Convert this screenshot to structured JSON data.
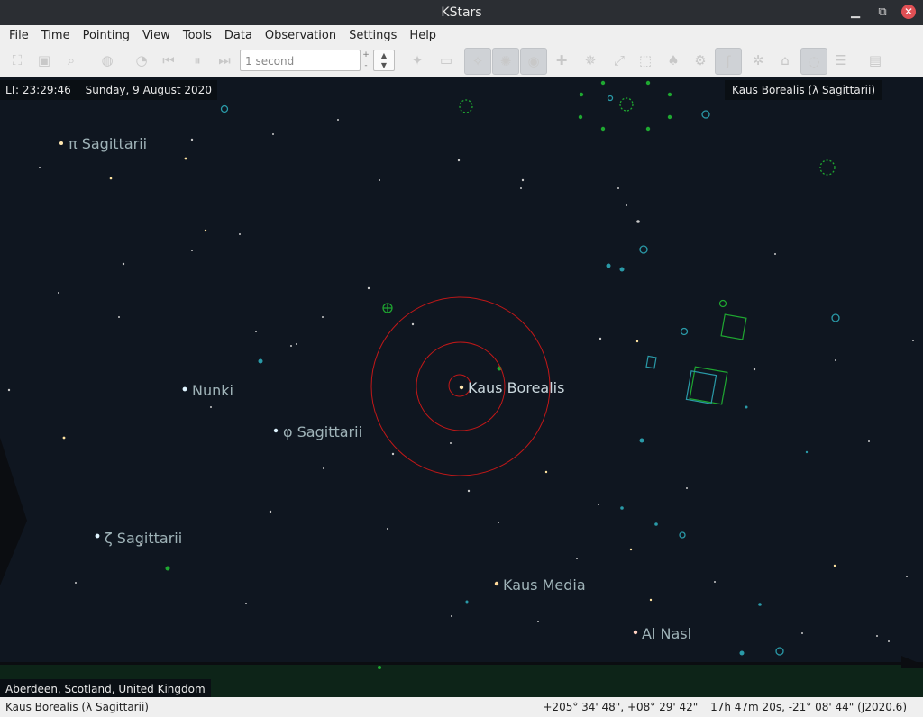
{
  "window": {
    "title": "KStars"
  },
  "menu": {
    "items": [
      {
        "label": "File"
      },
      {
        "label": "Time"
      },
      {
        "label": "Pointing"
      },
      {
        "label": "View"
      },
      {
        "label": "Tools"
      },
      {
        "label": "Data"
      },
      {
        "label": "Observation"
      },
      {
        "label": "Settings"
      },
      {
        "label": "Help"
      }
    ]
  },
  "toolbar": {
    "time_step": "1 second",
    "spin_up": "+",
    "spin_down": "-"
  },
  "sky": {
    "local_time": "LT: 23:29:46",
    "date": "Sunday, 9 August 2020",
    "focus_object": "Kaus Borealis (λ Sagittarii)",
    "location": "Aberdeen, Scotland, United Kingdom",
    "labels": {
      "pi_sgr": "π Sagittarii",
      "nunki": "Nunki",
      "phi_sgr": "φ Sagittarii",
      "zeta_sgr": "ζ Sagittarii",
      "kaus_borealis": "Kaus Borealis",
      "kaus_media": "Kaus Media",
      "al_nasl": "Al Nasl"
    }
  },
  "status": {
    "object": "Kaus Borealis (λ Sagittarii)",
    "altaz": "+205° 34' 48\", +08° 29' 42\"",
    "radec": "17h 47m 20s, -21° 08' 44\" (J2020.6)"
  }
}
